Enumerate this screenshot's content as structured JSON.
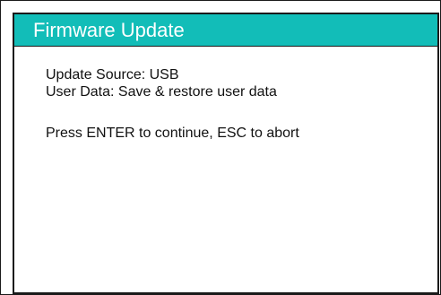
{
  "window": {
    "title": "Firmware Update"
  },
  "content": {
    "update_source_line": "Update Source:  USB",
    "user_data_line": "User Data:  Save & restore user data",
    "instruction_line": "Press ENTER to continue, ESC to abort"
  },
  "colors": {
    "title_bar_background": "#12bdb8",
    "title_text": "#ffffff",
    "body_text": "#111111",
    "border": "#1a1a1a"
  }
}
